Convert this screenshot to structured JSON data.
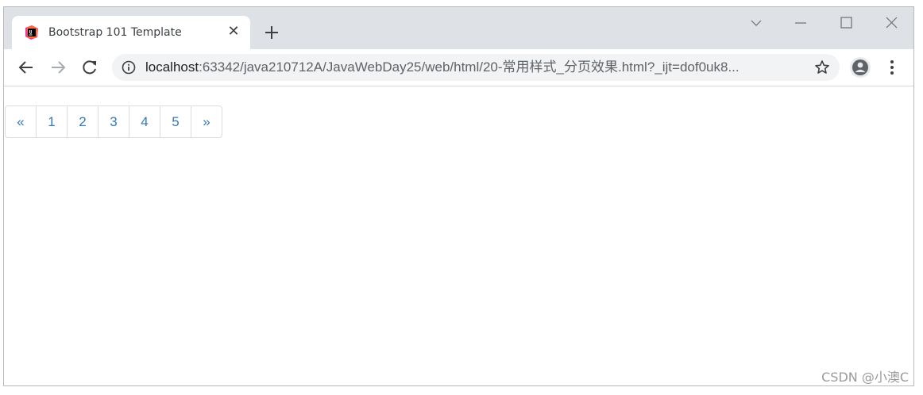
{
  "tab": {
    "title": "Bootstrap 101 Template",
    "favicon": "jetbrains-icon",
    "close_glyph": "✕"
  },
  "window_controls": [
    "chevron-down-icon",
    "minimize-icon",
    "maximize-icon",
    "close-icon"
  ],
  "toolbar": {
    "url_host": "localhost",
    "url_rest": ":63342/java210712A/JavaWebDay25/web/html/20-常用样式_分页效果.html?_ijt=dof0uk8..."
  },
  "pagination": {
    "items": [
      {
        "label": "«"
      },
      {
        "label": "1"
      },
      {
        "label": "2"
      },
      {
        "label": "3"
      },
      {
        "label": "4"
      },
      {
        "label": "5"
      },
      {
        "label": "»"
      }
    ],
    "link_color": "#337ab7",
    "border_color": "#dddddd"
  },
  "watermark": "CSDN @小澳C"
}
